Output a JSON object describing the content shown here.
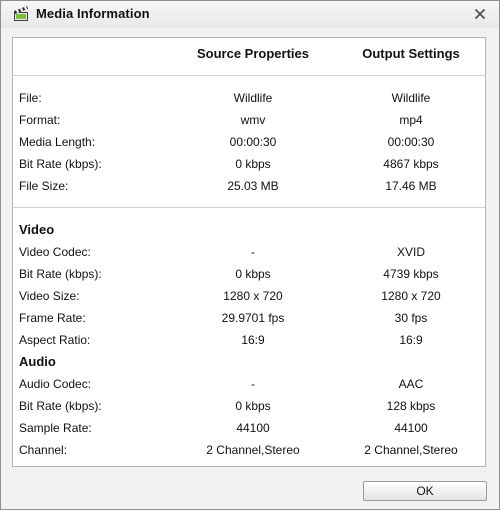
{
  "window": {
    "title": "Media Information",
    "icon": "clapperboard-icon",
    "close_icon": "close-icon"
  },
  "columns": {
    "source": "Source Properties",
    "output": "Output Settings"
  },
  "general": {
    "file": {
      "label": "File:",
      "source": "Wildlife",
      "output": "Wildlife"
    },
    "format": {
      "label": "Format:",
      "source": "wmv",
      "output": "mp4"
    },
    "media_length": {
      "label": "Media Length:",
      "source": "00:00:30",
      "output": "00:00:30"
    },
    "bit_rate": {
      "label": "Bit Rate (kbps):",
      "source": "0 kbps",
      "output": "4867 kbps"
    },
    "file_size": {
      "label": "File Size:",
      "source": "25.03 MB",
      "output": "17.46 MB"
    }
  },
  "video": {
    "heading": "Video",
    "codec": {
      "label": "Video Codec:",
      "source": "-",
      "output": "XVID"
    },
    "bit_rate": {
      "label": "Bit Rate (kbps):",
      "source": "0 kbps",
      "output": "4739 kbps"
    },
    "size": {
      "label": "Video Size:",
      "source": "1280 x 720",
      "output": "1280 x 720"
    },
    "frame_rate": {
      "label": "Frame Rate:",
      "source": "29.9701 fps",
      "output": "30 fps"
    },
    "aspect_ratio": {
      "label": "Aspect Ratio:",
      "source": "16:9",
      "output": "16:9"
    }
  },
  "audio": {
    "heading": "Audio",
    "codec": {
      "label": "Audio Codec:",
      "source": "-",
      "output": "AAC"
    },
    "bit_rate": {
      "label": "Bit Rate (kbps):",
      "source": "0 kbps",
      "output": "128 kbps"
    },
    "sample_rate": {
      "label": "Sample Rate:",
      "source": "44100",
      "output": "44100"
    },
    "channel": {
      "label": "Channel:",
      "source": "2 Channel,Stereo",
      "output": "2 Channel,Stereo"
    }
  },
  "buttons": {
    "ok": "OK"
  }
}
